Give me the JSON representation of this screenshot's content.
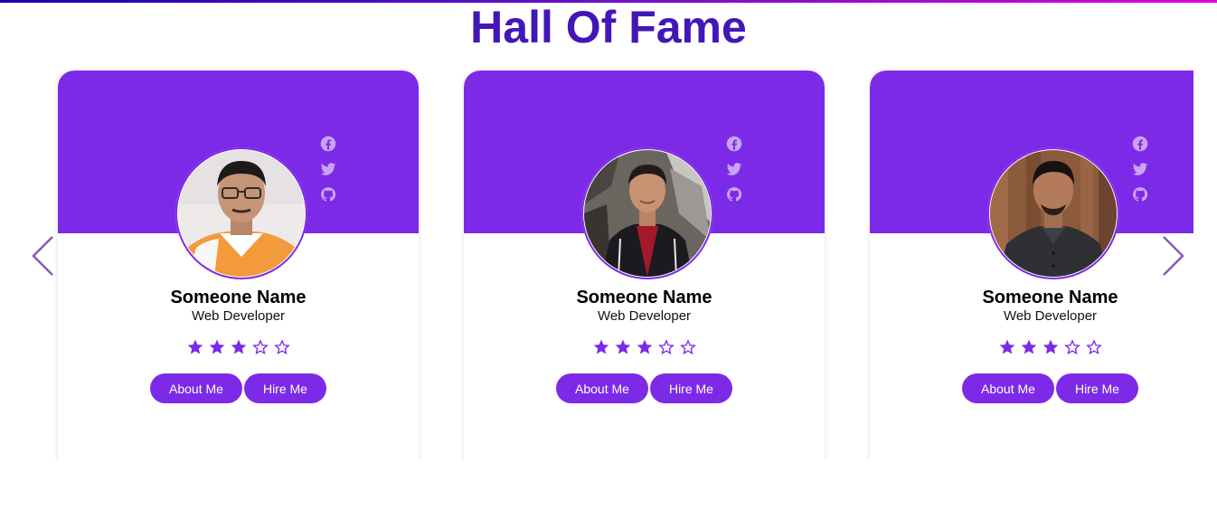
{
  "page": {
    "title": "Hall Of Fame"
  },
  "colors": {
    "accent": "#7d2ae8",
    "title": "#4316b8",
    "arrow": "#8a5ab8"
  },
  "nav": {
    "prev_icon": "chevron-left-icon",
    "next_icon": "chevron-right-icon"
  },
  "cards": [
    {
      "name": "Someone Name",
      "role": "Web Developer",
      "rating": 3,
      "rating_max": 5,
      "about_label": "About Me",
      "hire_label": "Hire Me",
      "social": [
        "facebook-icon",
        "twitter-icon",
        "github-icon"
      ]
    },
    {
      "name": "Someone Name",
      "role": "Web Developer",
      "rating": 3,
      "rating_max": 5,
      "about_label": "About Me",
      "hire_label": "Hire Me",
      "social": [
        "facebook-icon",
        "twitter-icon",
        "github-icon"
      ]
    },
    {
      "name": "Someone Name",
      "role": "Web Developer",
      "rating": 3,
      "rating_max": 5,
      "about_label": "About Me",
      "hire_label": "Hire Me",
      "social": [
        "facebook-icon",
        "twitter-icon",
        "github-icon"
      ]
    }
  ]
}
